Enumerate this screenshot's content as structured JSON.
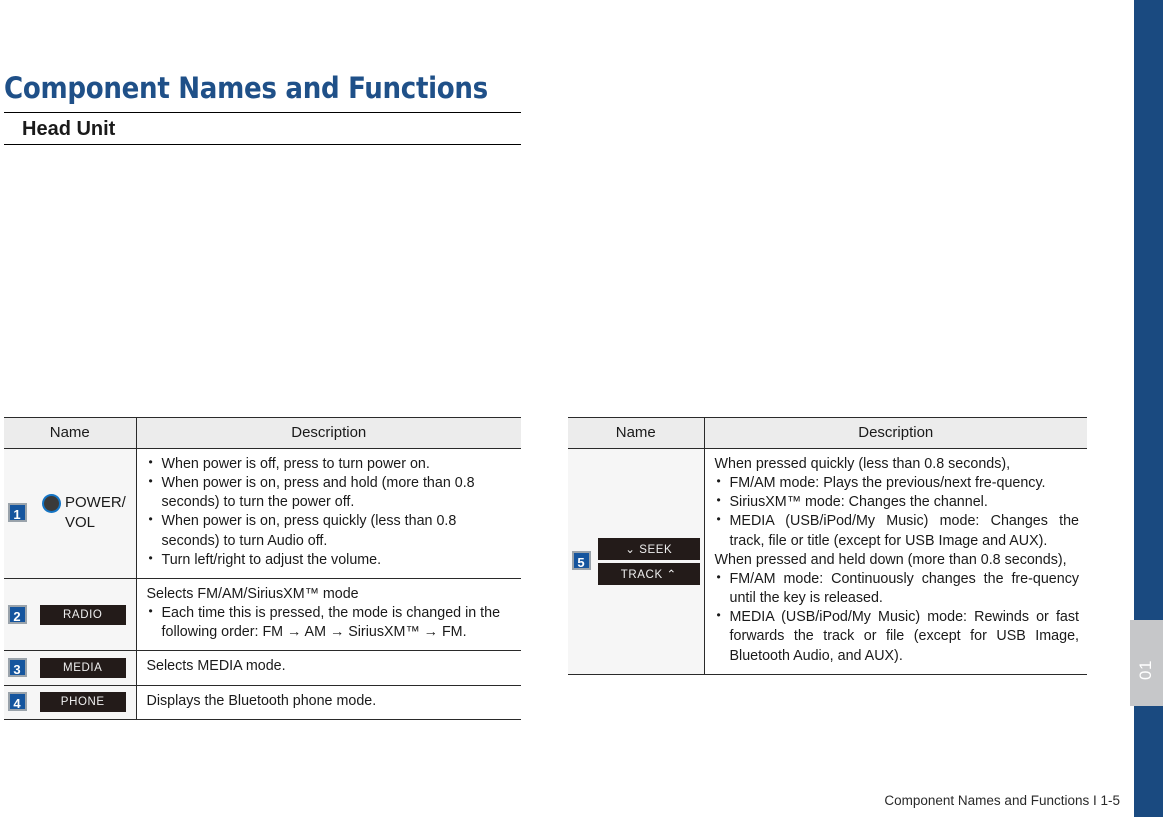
{
  "document": {
    "page_title": "Component Names and Functions",
    "section_title": "Head Unit",
    "footer": "Component Names and Functions I 1-5",
    "chapter_number": "01",
    "colors": {
      "title_blue": "#1f5088",
      "edge_bar_blue": "#1a4a80",
      "badge_blue": "#15559e",
      "chip_black": "#231b19",
      "header_gray": "#ececec",
      "name_col_gray": "#f6f6f6"
    }
  },
  "tables": {
    "left": {
      "headers": {
        "name": "Name",
        "description": "Description"
      },
      "rows": [
        {
          "number": "1",
          "name_type": "knob",
          "name_icon": "power-knob-icon",
          "name_label_line1": "POWER/",
          "name_label_line2": "VOL",
          "lead": "",
          "bullets": [
            "When power is off, press to turn power on.",
            "When power is on, press and hold (more than 0.8 seconds) to turn the power off.",
            "When power is on, press quickly (less than 0.8 seconds) to turn Audio off.",
            "Turn left/right to adjust the volume."
          ]
        },
        {
          "number": "2",
          "name_type": "chip",
          "chips": [
            "RADIO"
          ],
          "lead": "Selects FM/AM/SiriusXM™ mode",
          "bullets": [
            "Each time this is pressed, the mode is changed in the following order: FM → AM →  SiriusXM™ → FM."
          ]
        },
        {
          "number": "3",
          "name_type": "chip",
          "chips": [
            "MEDIA"
          ],
          "lead": "Selects MEDIA mode.",
          "bullets": []
        },
        {
          "number": "4",
          "name_type": "chip",
          "chips": [
            "PHONE"
          ],
          "lead": "Displays the Bluetooth phone mode.",
          "bullets": []
        }
      ]
    },
    "right": {
      "headers": {
        "name": "Name",
        "description": "Description"
      },
      "rows": [
        {
          "number": "5",
          "name_type": "chip-stack",
          "chips": [
            "⌄ SEEK",
            "TRACK ⌃"
          ],
          "chip_seek": "SEEK",
          "chip_track": "TRACK",
          "lead1": "When pressed quickly (less than 0.8 seconds),",
          "bullets1": [
            "FM/AM mode: Plays the previous/next fre-quency.",
            "SiriusXM™ mode: Changes the channel.",
            "MEDIA (USB/iPod/My Music) mode: Changes the track, file or title (except for USB Image and AUX)."
          ],
          "lead2": "When pressed and held down (more than 0.8 seconds),",
          "bullets2": [
            "FM/AM mode: Continuously changes the fre-quency until the key is released.",
            "MEDIA (USB/iPod/My Music) mode: Rewinds or fast forwards the track or file (except for USB Image, Bluetooth Audio, and AUX)."
          ]
        }
      ]
    }
  }
}
